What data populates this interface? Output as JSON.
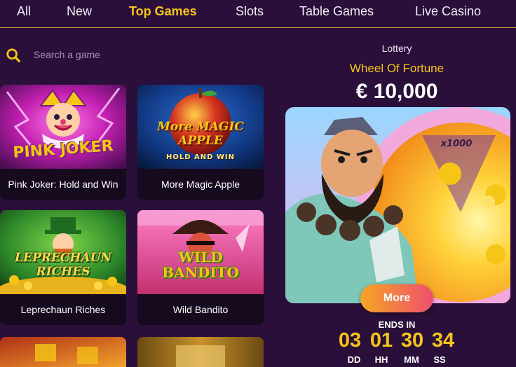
{
  "nav": {
    "items": [
      {
        "label": "All"
      },
      {
        "label": "New"
      },
      {
        "label": "Top Games"
      },
      {
        "label": "Slots"
      },
      {
        "label": "Table Games"
      },
      {
        "label": "Live Casino"
      }
    ],
    "active": "Top Games"
  },
  "search": {
    "placeholder": "Search a game",
    "icon": "search-icon"
  },
  "games": [
    {
      "title": "Pink Joker: Hold and Win",
      "logo_text": "PINK JOKER"
    },
    {
      "title": "More Magic Apple",
      "logo_text": "More MAGIC APPLE",
      "logo_sub": "HOLD AND WIN"
    },
    {
      "title": "Leprechaun Riches",
      "logo_text": "LEPRECHAUN RICHES"
    },
    {
      "title": "Wild Bandito",
      "logo_text": "WILD BANDITO"
    }
  ],
  "lottery": {
    "category": "Lottery",
    "name": "Wheel Of Fortune",
    "amount": "€ 10,000",
    "multiplier": "x1000",
    "more_label": "More",
    "ends_label": "ENDS IN",
    "countdown": [
      {
        "value": "03",
        "unit": "DD"
      },
      {
        "value": "01",
        "unit": "HH"
      },
      {
        "value": "30",
        "unit": "MM"
      },
      {
        "value": "34",
        "unit": "SS"
      }
    ]
  },
  "colors": {
    "background": "#2a0f3a",
    "accent": "#f5c518",
    "button_start": "#f5a623",
    "button_end": "#ee4f6e"
  }
}
